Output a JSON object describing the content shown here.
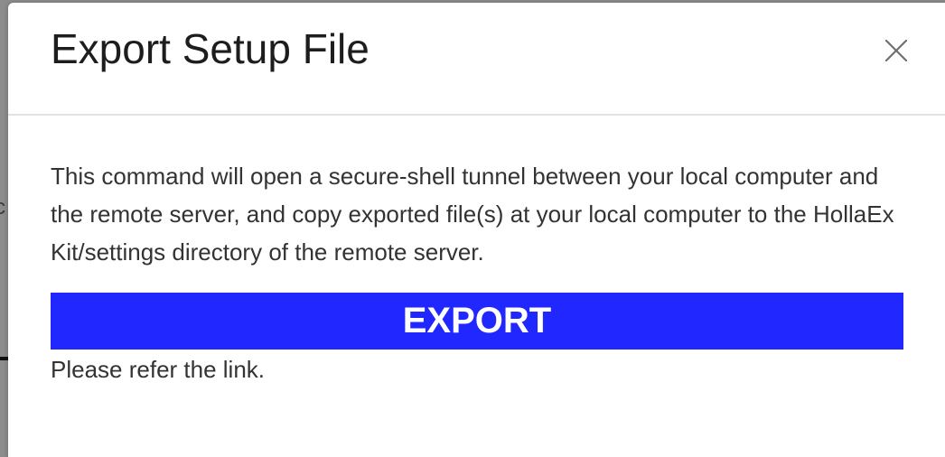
{
  "backdrop": {
    "partial_glyph": "c"
  },
  "modal": {
    "title": "Export Setup File",
    "close_icon": "close-icon",
    "description": "This command will open a secure-shell tunnel between your local computer and the remote server, and copy exported file(s) at your local computer to the HollaEx Kit/settings directory of the remote server.",
    "export_label": "EXPORT",
    "refer_text": "Please refer the link."
  },
  "colors": {
    "accent": "#2027ff",
    "text": "#333333",
    "title": "#1d1d1d",
    "divider": "#e2e2e2",
    "backdrop": "#8d8d8d"
  }
}
